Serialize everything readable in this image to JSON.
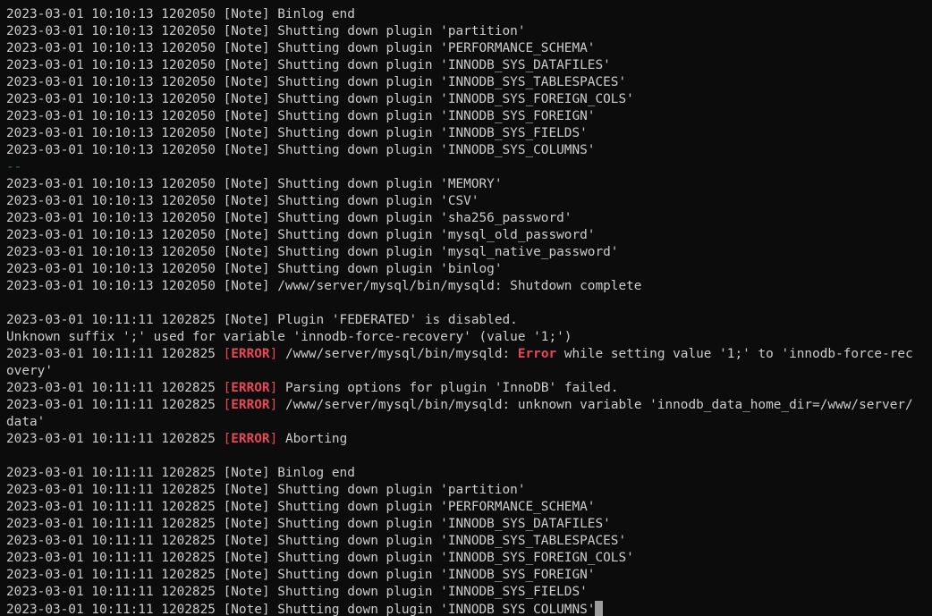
{
  "terminal": {
    "lines": [
      {
        "kind": "plain",
        "text": "2023-03-01 10:10:13 1202050 [Note] Binlog end"
      },
      {
        "kind": "plain",
        "text": "2023-03-01 10:10:13 1202050 [Note] Shutting down plugin 'partition'"
      },
      {
        "kind": "plain",
        "text": "2023-03-01 10:10:13 1202050 [Note] Shutting down plugin 'PERFORMANCE_SCHEMA'"
      },
      {
        "kind": "plain",
        "text": "2023-03-01 10:10:13 1202050 [Note] Shutting down plugin 'INNODB_SYS_DATAFILES'"
      },
      {
        "kind": "plain",
        "text": "2023-03-01 10:10:13 1202050 [Note] Shutting down plugin 'INNODB_SYS_TABLESPACES'"
      },
      {
        "kind": "plain",
        "text": "2023-03-01 10:10:13 1202050 [Note] Shutting down plugin 'INNODB_SYS_FOREIGN_COLS'"
      },
      {
        "kind": "plain",
        "text": "2023-03-01 10:10:13 1202050 [Note] Shutting down plugin 'INNODB_SYS_FOREIGN'"
      },
      {
        "kind": "plain",
        "text": "2023-03-01 10:10:13 1202050 [Note] Shutting down plugin 'INNODB_SYS_FIELDS'"
      },
      {
        "kind": "plain",
        "text": "2023-03-01 10:10:13 1202050 [Note] Shutting down plugin 'INNODB_SYS_COLUMNS'"
      },
      {
        "kind": "sep",
        "text": "--"
      },
      {
        "kind": "plain",
        "text": "2023-03-01 10:10:13 1202050 [Note] Shutting down plugin 'MEMORY'"
      },
      {
        "kind": "plain",
        "text": "2023-03-01 10:10:13 1202050 [Note] Shutting down plugin 'CSV'"
      },
      {
        "kind": "plain",
        "text": "2023-03-01 10:10:13 1202050 [Note] Shutting down plugin 'sha256_password'"
      },
      {
        "kind": "plain",
        "text": "2023-03-01 10:10:13 1202050 [Note] Shutting down plugin 'mysql_old_password'"
      },
      {
        "kind": "plain",
        "text": "2023-03-01 10:10:13 1202050 [Note] Shutting down plugin 'mysql_native_password'"
      },
      {
        "kind": "plain",
        "text": "2023-03-01 10:10:13 1202050 [Note] Shutting down plugin 'binlog'"
      },
      {
        "kind": "plain",
        "text": "2023-03-01 10:10:13 1202050 [Note] /www/server/mysql/bin/mysqld: Shutdown complete"
      },
      {
        "kind": "plain",
        "text": ""
      },
      {
        "kind": "plain",
        "text": "2023-03-01 10:11:11 1202825 [Note] Plugin 'FEDERATED' is disabled."
      },
      {
        "kind": "plain",
        "text": "Unknown suffix ';' used for variable 'innodb-force-recovery' (value '1;')"
      },
      {
        "kind": "err2",
        "pre": "2023-03-01 10:11:11 1202825 ",
        "mid": "/www/server/mysql/bin/mysqld: ",
        "word": "Error",
        "post": " while setting value '1;' to 'innodb-force-rec"
      },
      {
        "kind": "plain",
        "text": "overy'"
      },
      {
        "kind": "err",
        "pre": "2023-03-01 10:11:11 1202825 ",
        "post": "Parsing options for plugin 'InnoDB' failed."
      },
      {
        "kind": "err",
        "pre": "2023-03-01 10:11:11 1202825 ",
        "post": "/www/server/mysql/bin/mysqld: unknown variable 'innodb_data_home_dir=/www/server/"
      },
      {
        "kind": "plain",
        "text": "data'"
      },
      {
        "kind": "err",
        "pre": "2023-03-01 10:11:11 1202825 ",
        "post": "Aborting"
      },
      {
        "kind": "plain",
        "text": ""
      },
      {
        "kind": "plain",
        "text": "2023-03-01 10:11:11 1202825 [Note] Binlog end"
      },
      {
        "kind": "plain",
        "text": "2023-03-01 10:11:11 1202825 [Note] Shutting down plugin 'partition'"
      },
      {
        "kind": "plain",
        "text": "2023-03-01 10:11:11 1202825 [Note] Shutting down plugin 'PERFORMANCE_SCHEMA'"
      },
      {
        "kind": "plain",
        "text": "2023-03-01 10:11:11 1202825 [Note] Shutting down plugin 'INNODB_SYS_DATAFILES'"
      },
      {
        "kind": "plain",
        "text": "2023-03-01 10:11:11 1202825 [Note] Shutting down plugin 'INNODB_SYS_TABLESPACES'"
      },
      {
        "kind": "plain",
        "text": "2023-03-01 10:11:11 1202825 [Note] Shutting down plugin 'INNODB_SYS_FOREIGN_COLS'"
      },
      {
        "kind": "plain",
        "text": "2023-03-01 10:11:11 1202825 [Note] Shutting down plugin 'INNODB_SYS_FOREIGN'"
      },
      {
        "kind": "plain",
        "text": "2023-03-01 10:11:11 1202825 [Note] Shutting down plugin 'INNODB_SYS_FIELDS'"
      },
      {
        "kind": "cursor",
        "text": "2023-03-01 10:11:11 1202825 [Note] Shutting down plugin 'INNODB_SYS_COLUMNS'"
      }
    ],
    "error_tag": "ERROR",
    "colors": {
      "background": "#0c0c0c",
      "foreground": "#cccccc",
      "error": "#e74856",
      "separator": "#2e7d32"
    }
  }
}
